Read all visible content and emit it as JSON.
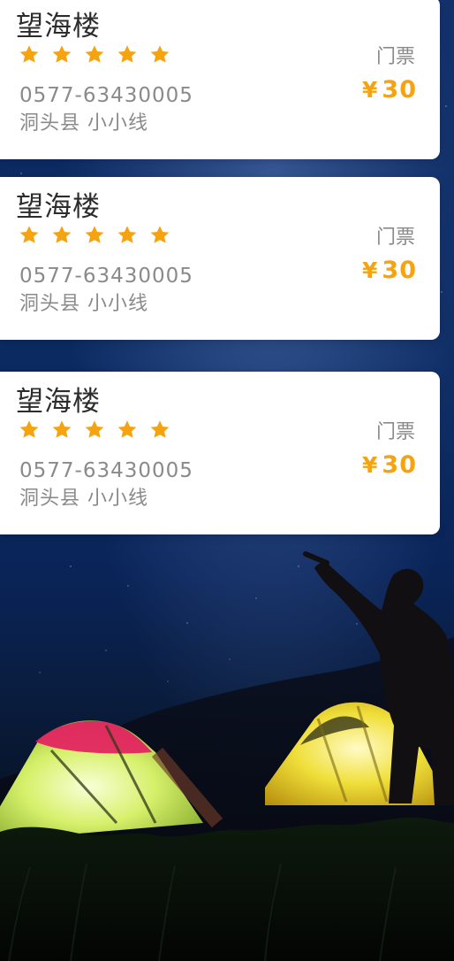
{
  "cards": [
    {
      "title": "望海楼",
      "rating": 5,
      "rating_max": 5,
      "phone": "0577-63430005",
      "address": "洞头县 小小线",
      "ticket_label": "门票",
      "currency": "¥",
      "price": "30"
    },
    {
      "title": "望海楼",
      "rating": 5,
      "rating_max": 5,
      "phone": "0577-63430005",
      "address": "洞头县 小小线",
      "ticket_label": "门票",
      "currency": "¥",
      "price": "30"
    },
    {
      "title": "望海楼",
      "rating": 5,
      "rating_max": 5,
      "phone": "0577-63430005",
      "address": "洞头县 小小线",
      "ticket_label": "门票",
      "currency": "¥",
      "price": "30"
    }
  ],
  "colors": {
    "card_background": "#ffffff",
    "title_text": "#2c2c2c",
    "secondary_text": "#8a8a8a",
    "star": "#f5a310",
    "price": "#f5a310"
  },
  "icons": {
    "rating": "star-icon"
  }
}
